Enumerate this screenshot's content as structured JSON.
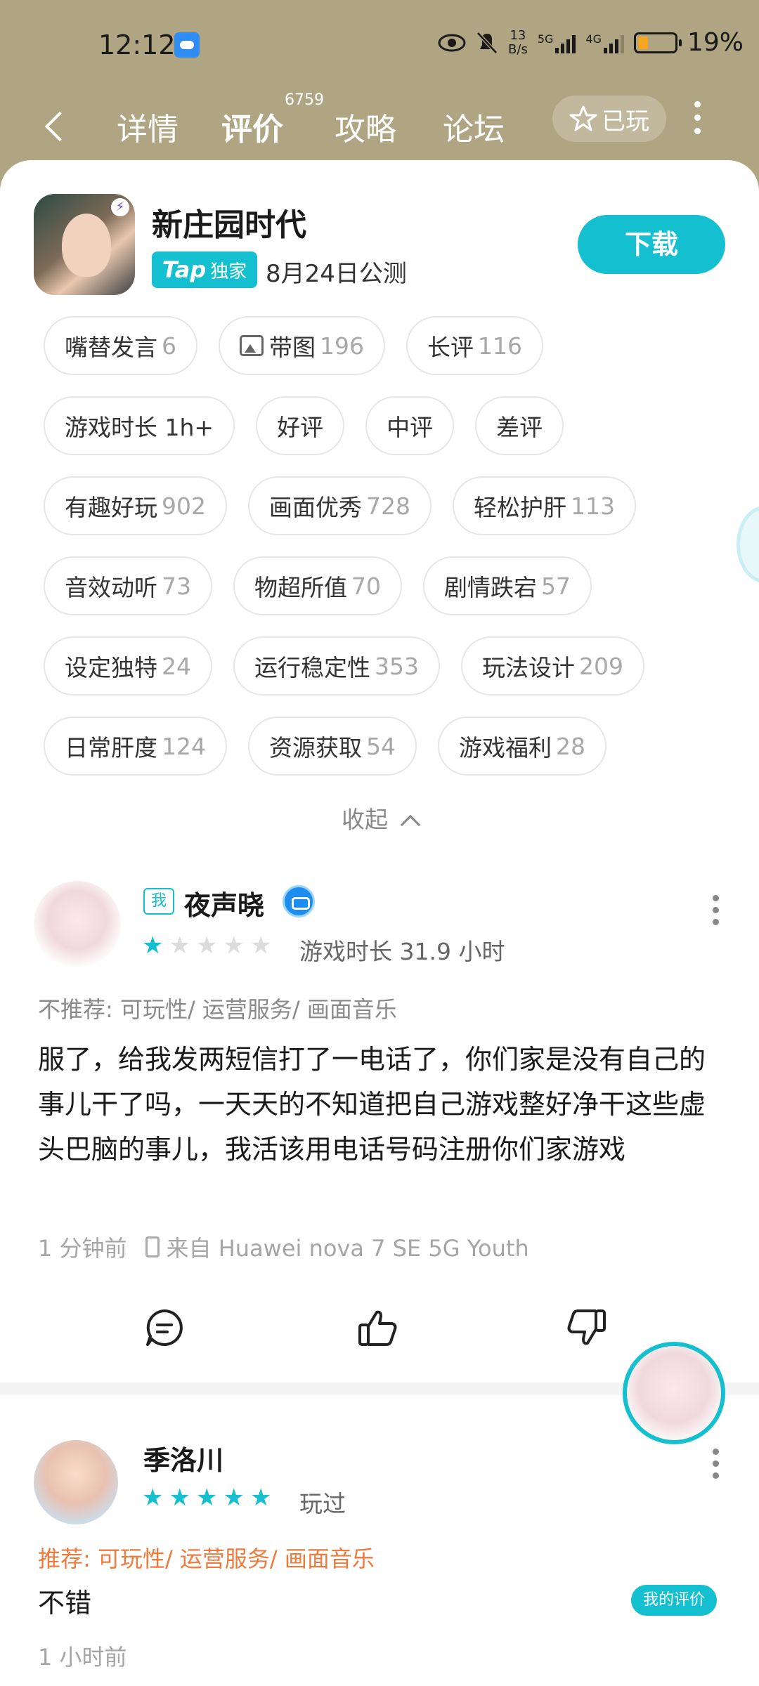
{
  "status_bar": {
    "time": "12:12",
    "net_speed_top": "13",
    "net_speed_unit": "B/s",
    "sig1": "5G",
    "sig2": "4G",
    "battery": "19%"
  },
  "nav": {
    "tabs": [
      "详情",
      "评价",
      "攻略",
      "论坛"
    ],
    "active_tab_count": "6759",
    "played_label": "已玩"
  },
  "app": {
    "name": "新庄园时代",
    "tap_label": "Tap",
    "exclusive_label": "独家",
    "release": "8月24日公测",
    "download_label": "下载"
  },
  "filters": [
    [
      {
        "label": "嘴替发言",
        "count": "6"
      },
      {
        "label": "带图",
        "count": "196",
        "icon": "image-icon"
      },
      {
        "label": "长评",
        "count": "116"
      }
    ],
    [
      {
        "label": "游戏时长 1h+",
        "count": ""
      },
      {
        "label": "好评",
        "count": ""
      },
      {
        "label": "中评",
        "count": ""
      },
      {
        "label": "差评",
        "count": ""
      }
    ],
    [
      {
        "label": "有趣好玩",
        "count": "902"
      },
      {
        "label": "画面优秀",
        "count": "728"
      },
      {
        "label": "轻松护肝",
        "count": "113"
      }
    ],
    [
      {
        "label": "音效动听",
        "count": "73"
      },
      {
        "label": "物超所值",
        "count": "70"
      },
      {
        "label": "剧情跌宕",
        "count": "57"
      }
    ],
    [
      {
        "label": "设定独特",
        "count": "24"
      },
      {
        "label": "运行稳定性",
        "count": "353"
      },
      {
        "label": "玩法设计",
        "count": "209"
      }
    ],
    [
      {
        "label": "日常肝度",
        "count": "124"
      },
      {
        "label": "资源获取",
        "count": "54"
      },
      {
        "label": "游戏福利",
        "count": "28"
      }
    ]
  ],
  "collapse_label": "收起",
  "reviews": [
    {
      "me_tag": "我",
      "user": "夜声晓",
      "stars": 1,
      "playtime": "游戏时长 31.9 小时",
      "verdict": "不推荐: 可玩性/ 运营服务/ 画面音乐",
      "text": "服了，给我发两短信打了一电话了，你们家是没有自己的事儿干了吗，一天天的不知道把自己游戏整好净干这些虚头巴脑的事儿，我活该用电话号码注册你们家游戏",
      "time": "1 分钟前",
      "device": "来自 Huawei nova 7 SE 5G Youth"
    },
    {
      "user": "季洛川",
      "stars": 5,
      "playtime": "玩过",
      "verdict": "推荐: 可玩性/ 运营服务/ 画面音乐",
      "text": "不错",
      "time": "1 小时前"
    }
  ],
  "my_review_label": "我的评价",
  "colors": {
    "accent": "#14c0cf",
    "header_bg": "#b0a583",
    "positive": "#f07a3c"
  }
}
